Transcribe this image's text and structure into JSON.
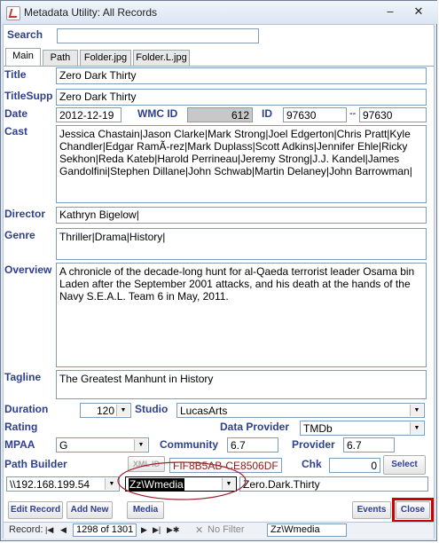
{
  "window": {
    "title": "Metadata Utility: All Records",
    "minimize_glyph": "–",
    "close_glyph": "✕"
  },
  "search": {
    "label": "Search",
    "value": ""
  },
  "tabs": [
    {
      "label": "Main"
    },
    {
      "label": "Path"
    },
    {
      "label": "Folder.jpg"
    },
    {
      "label": "Folder.L.jpg"
    }
  ],
  "fields": {
    "title": {
      "label": "Title",
      "value": "Zero Dark Thirty"
    },
    "title_supp": {
      "label": "TitleSupp",
      "value": "Zero Dark Thirty"
    },
    "date": {
      "label": "Date",
      "value": "2012-12-19"
    },
    "wmc_id": {
      "label": "WMC ID",
      "value": "612"
    },
    "id": {
      "label": "ID",
      "value": "97630",
      "range_sep": "--",
      "value2": "97630"
    },
    "cast": {
      "label": "Cast",
      "value": "Jessica Chastain|Jason Clarke|Mark Strong|Joel Edgerton|Chris Pratt|Kyle Chandler|Edgar RamÃ-rez|Mark Duplass|Scott Adkins|Jennifer Ehle|Ricky Sekhon|Reda Kateb|Harold Perrineau|Jeremy Strong|J.J. Kandel|James Gandolfini|Stephen Dillane|John Schwab|Martin Delaney|John Barrowman|"
    },
    "director": {
      "label": "Director",
      "value": "Kathryn Bigelow|"
    },
    "genre": {
      "label": "Genre",
      "value": "Thriller|Drama|History|"
    },
    "overview": {
      "label": "Overview",
      "value": "A chronicle of the decade-long hunt for al-Qaeda terrorist leader Osama bin Laden after the September 2001 attacks, and his death at the hands of the Navy S.E.A.L. Team 6 in May, 2011."
    },
    "tagline": {
      "label": "Tagline",
      "value": "The Greatest Manhunt in History"
    },
    "duration": {
      "label": "Duration",
      "value": "120"
    },
    "studio": {
      "label": "Studio",
      "value": "LucasArts"
    },
    "rating": {
      "label": "Rating"
    },
    "data_provider": {
      "label": "Data Provider",
      "value": "TMDb"
    },
    "mpaa": {
      "label": "MPAA",
      "value": "G"
    },
    "community": {
      "label": "Community",
      "value": "6.7"
    },
    "provider": {
      "label": "Provider",
      "value": "6.7"
    },
    "path_builder": {
      "label": "Path Builder"
    },
    "xml_id": {
      "label": "XML ID"
    },
    "hash": {
      "value": "FIF8B5AB-CE8506DF"
    },
    "chk": {
      "label": "Chk",
      "value": "0"
    },
    "server": {
      "value": "\\\\192.168.199.54"
    },
    "share": {
      "value": "Zz\\Wmedia"
    },
    "folder": {
      "value": "Zero.Dark.Thirty"
    }
  },
  "buttons": {
    "select": "Select",
    "edit_record": "Edit Record",
    "add_new": "Add New",
    "media": "Media",
    "events": "Events",
    "close": "Close"
  },
  "status": {
    "record_label": "Record:",
    "record_value": "1298 of 1301",
    "filter": "No Filter",
    "search_value": "Zz\\Wmedia"
  },
  "colors": {
    "label": "#2d3f8f",
    "highlight": "#cc0000",
    "annotation": "#a02030"
  }
}
